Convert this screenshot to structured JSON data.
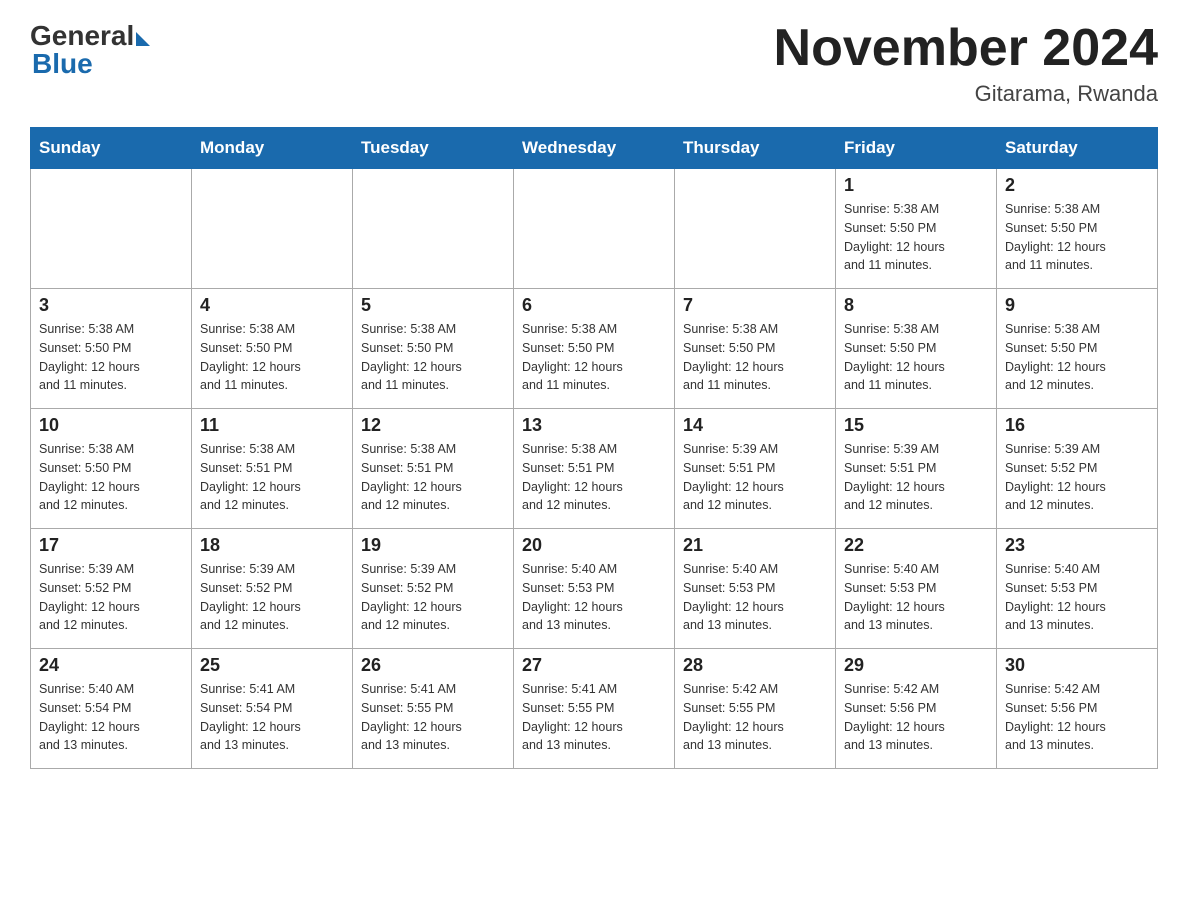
{
  "logo": {
    "general": "General",
    "blue": "Blue"
  },
  "header": {
    "month_year": "November 2024",
    "location": "Gitarama, Rwanda"
  },
  "weekdays": [
    "Sunday",
    "Monday",
    "Tuesday",
    "Wednesday",
    "Thursday",
    "Friday",
    "Saturday"
  ],
  "weeks": [
    [
      {
        "day": "",
        "info": ""
      },
      {
        "day": "",
        "info": ""
      },
      {
        "day": "",
        "info": ""
      },
      {
        "day": "",
        "info": ""
      },
      {
        "day": "",
        "info": ""
      },
      {
        "day": "1",
        "info": "Sunrise: 5:38 AM\nSunset: 5:50 PM\nDaylight: 12 hours\nand 11 minutes."
      },
      {
        "day": "2",
        "info": "Sunrise: 5:38 AM\nSunset: 5:50 PM\nDaylight: 12 hours\nand 11 minutes."
      }
    ],
    [
      {
        "day": "3",
        "info": "Sunrise: 5:38 AM\nSunset: 5:50 PM\nDaylight: 12 hours\nand 11 minutes."
      },
      {
        "day": "4",
        "info": "Sunrise: 5:38 AM\nSunset: 5:50 PM\nDaylight: 12 hours\nand 11 minutes."
      },
      {
        "day": "5",
        "info": "Sunrise: 5:38 AM\nSunset: 5:50 PM\nDaylight: 12 hours\nand 11 minutes."
      },
      {
        "day": "6",
        "info": "Sunrise: 5:38 AM\nSunset: 5:50 PM\nDaylight: 12 hours\nand 11 minutes."
      },
      {
        "day": "7",
        "info": "Sunrise: 5:38 AM\nSunset: 5:50 PM\nDaylight: 12 hours\nand 11 minutes."
      },
      {
        "day": "8",
        "info": "Sunrise: 5:38 AM\nSunset: 5:50 PM\nDaylight: 12 hours\nand 11 minutes."
      },
      {
        "day": "9",
        "info": "Sunrise: 5:38 AM\nSunset: 5:50 PM\nDaylight: 12 hours\nand 12 minutes."
      }
    ],
    [
      {
        "day": "10",
        "info": "Sunrise: 5:38 AM\nSunset: 5:50 PM\nDaylight: 12 hours\nand 12 minutes."
      },
      {
        "day": "11",
        "info": "Sunrise: 5:38 AM\nSunset: 5:51 PM\nDaylight: 12 hours\nand 12 minutes."
      },
      {
        "day": "12",
        "info": "Sunrise: 5:38 AM\nSunset: 5:51 PM\nDaylight: 12 hours\nand 12 minutes."
      },
      {
        "day": "13",
        "info": "Sunrise: 5:38 AM\nSunset: 5:51 PM\nDaylight: 12 hours\nand 12 minutes."
      },
      {
        "day": "14",
        "info": "Sunrise: 5:39 AM\nSunset: 5:51 PM\nDaylight: 12 hours\nand 12 minutes."
      },
      {
        "day": "15",
        "info": "Sunrise: 5:39 AM\nSunset: 5:51 PM\nDaylight: 12 hours\nand 12 minutes."
      },
      {
        "day": "16",
        "info": "Sunrise: 5:39 AM\nSunset: 5:52 PM\nDaylight: 12 hours\nand 12 minutes."
      }
    ],
    [
      {
        "day": "17",
        "info": "Sunrise: 5:39 AM\nSunset: 5:52 PM\nDaylight: 12 hours\nand 12 minutes."
      },
      {
        "day": "18",
        "info": "Sunrise: 5:39 AM\nSunset: 5:52 PM\nDaylight: 12 hours\nand 12 minutes."
      },
      {
        "day": "19",
        "info": "Sunrise: 5:39 AM\nSunset: 5:52 PM\nDaylight: 12 hours\nand 12 minutes."
      },
      {
        "day": "20",
        "info": "Sunrise: 5:40 AM\nSunset: 5:53 PM\nDaylight: 12 hours\nand 13 minutes."
      },
      {
        "day": "21",
        "info": "Sunrise: 5:40 AM\nSunset: 5:53 PM\nDaylight: 12 hours\nand 13 minutes."
      },
      {
        "day": "22",
        "info": "Sunrise: 5:40 AM\nSunset: 5:53 PM\nDaylight: 12 hours\nand 13 minutes."
      },
      {
        "day": "23",
        "info": "Sunrise: 5:40 AM\nSunset: 5:53 PM\nDaylight: 12 hours\nand 13 minutes."
      }
    ],
    [
      {
        "day": "24",
        "info": "Sunrise: 5:40 AM\nSunset: 5:54 PM\nDaylight: 12 hours\nand 13 minutes."
      },
      {
        "day": "25",
        "info": "Sunrise: 5:41 AM\nSunset: 5:54 PM\nDaylight: 12 hours\nand 13 minutes."
      },
      {
        "day": "26",
        "info": "Sunrise: 5:41 AM\nSunset: 5:55 PM\nDaylight: 12 hours\nand 13 minutes."
      },
      {
        "day": "27",
        "info": "Sunrise: 5:41 AM\nSunset: 5:55 PM\nDaylight: 12 hours\nand 13 minutes."
      },
      {
        "day": "28",
        "info": "Sunrise: 5:42 AM\nSunset: 5:55 PM\nDaylight: 12 hours\nand 13 minutes."
      },
      {
        "day": "29",
        "info": "Sunrise: 5:42 AM\nSunset: 5:56 PM\nDaylight: 12 hours\nand 13 minutes."
      },
      {
        "day": "30",
        "info": "Sunrise: 5:42 AM\nSunset: 5:56 PM\nDaylight: 12 hours\nand 13 minutes."
      }
    ]
  ]
}
